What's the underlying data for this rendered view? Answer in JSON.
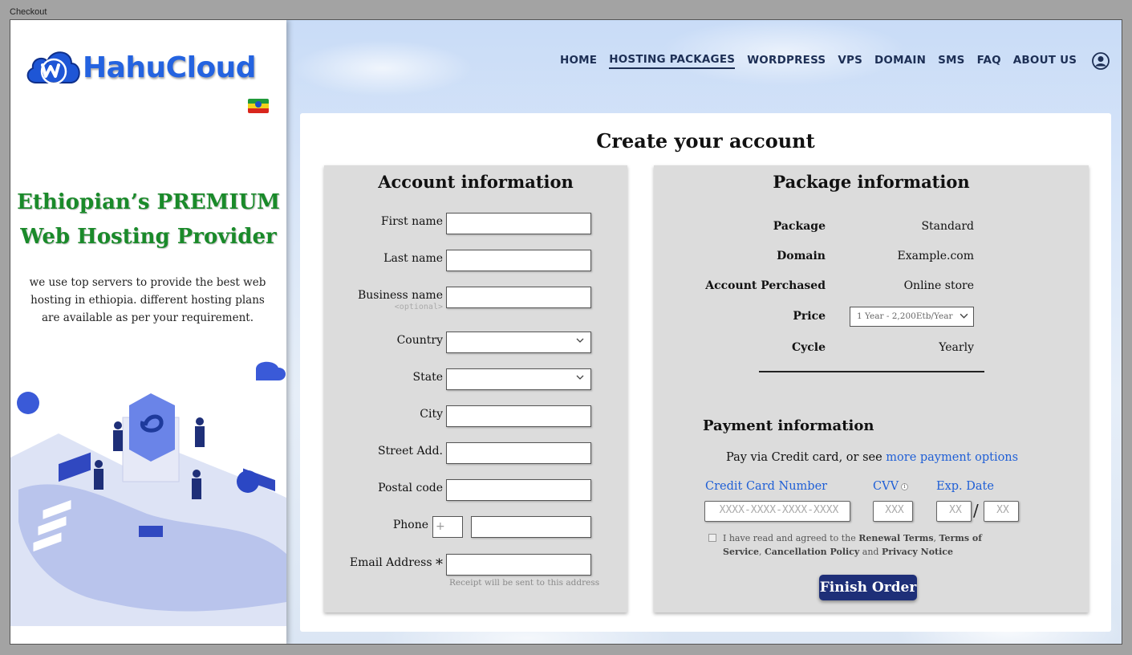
{
  "window": {
    "title": "Checkout"
  },
  "brand": {
    "name": "HahuCloud"
  },
  "left": {
    "tagline_1": "Ethiopian’s PREMIUM",
    "tagline_2": "Web Hosting Provider",
    "description": "we use top servers to provide the best web hosting in ethiopia. different hosting plans are available as per your requirement."
  },
  "nav": {
    "items": [
      "HOME",
      "HOSTING PACKAGES",
      "WORDPRESS",
      "VPS",
      "DOMAIN",
      "SMS",
      "FAQ",
      "ABOUT US"
    ],
    "active": "HOSTING PACKAGES",
    "user_icon": "user-circle-icon"
  },
  "page": {
    "title": "Create your account"
  },
  "account": {
    "title": "Account information",
    "first_name": "First name",
    "last_name": "Last name",
    "business_name": "Business name",
    "optional": "<optional>",
    "country": "Country",
    "state": "State",
    "city": "City",
    "street": "Street Add.",
    "postal": "Postal code",
    "phone": "Phone",
    "phone_prefix": "+",
    "email": "Email Address",
    "email_required": "*",
    "receipt_note": "Receipt will be sent to this address"
  },
  "package": {
    "title": "Package information",
    "rows": {
      "package_label": "Package",
      "package_value": "Standard",
      "domain_label": "Domain",
      "domain_value": "Example.com",
      "account_label": "Account Perchased",
      "account_value": "Online store",
      "price_label": "Price",
      "price_value": "1 Year - 2,200Etb/Year",
      "cycle_label": "Cycle",
      "cycle_value": "Yearly"
    }
  },
  "payment": {
    "title": "Payment information",
    "pay_prefix": "Pay via Credit card, or see",
    "more_options": "more payment options",
    "cc_label": "Credit Card Number",
    "cc_placeholder": "XXXX-XXXX-XXXX-XXXX",
    "cvv_label": "CVV",
    "cvv_info": "i",
    "cvv_placeholder": "XXX",
    "exp_label": "Exp. Date",
    "exp_month_placeholder": "XX",
    "exp_slash": "/",
    "exp_year_placeholder": "XX",
    "agree_prefix": "I have read and agreed to the",
    "renewal_terms": "Renewal Terms",
    "comma_1": ",",
    "terms_of_service": "Terms of  Service",
    "comma_2": ",",
    "cancellation": "Cancellation Policy",
    "and": "and",
    "privacy": "Privacy Notice",
    "finish_button": "Finish Order"
  },
  "colors": {
    "brand_blue": "#2463e0",
    "tagline_green": "#1a8a2a",
    "nav_text": "#1d2f55",
    "link_blue": "#1f5fd6",
    "finish_button_bg": "#1e2f78",
    "panel_bg": "#dcdcdc"
  }
}
